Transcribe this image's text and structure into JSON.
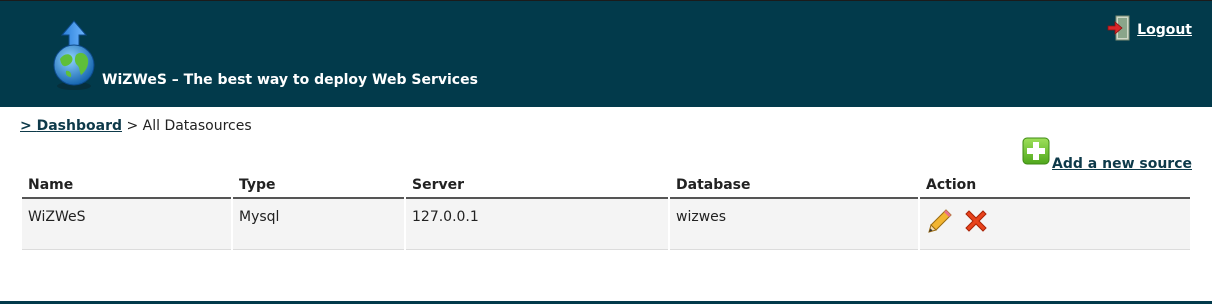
{
  "header": {
    "title": "WiZWeS – The best way to deploy Web Services",
    "logout_label": "Logout",
    "background_color": "#023a4b"
  },
  "breadcrumb": {
    "prefix": "> ",
    "dashboard_label": "Dashboard",
    "separator": " > ",
    "current": "All Datasources"
  },
  "actions": {
    "add_source_label": "Add a new source"
  },
  "table": {
    "columns": [
      "Name",
      "Type",
      "Server",
      "Database",
      "Action"
    ],
    "rows": [
      {
        "name": "WiZWeS",
        "type": "Mysql",
        "server": "127.0.0.1",
        "database": "wizwes",
        "actions": [
          "edit-pencil-icon",
          "delete-x-icon"
        ]
      }
    ]
  },
  "icons": {
    "logo": "globe-upload-arrow-icon",
    "logout": "logout-door-icon",
    "add": "green-plus-icon"
  }
}
